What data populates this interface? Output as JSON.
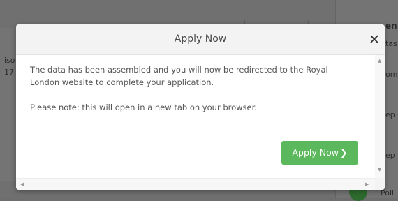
{
  "background": {
    "left_fragments": [
      "iso",
      "17"
    ],
    "right_fragments": [
      "en",
      "tas",
      "om",
      "ep",
      "ep",
      "Poli"
    ]
  },
  "modal": {
    "title": "Apply Now",
    "close_glyph": "✕",
    "message_line1": "The data has been assembled and you will now be redirected to the Royal London website to complete your application.",
    "message_line2": "Please note: this will open in a new tab on your browser.",
    "apply_label": "Apply Now",
    "apply_chevron": "❯",
    "accent_color": "#5cb85c"
  },
  "scrollbar": {
    "up_arrow": "▲",
    "down_arrow": "▼",
    "left_arrow": "◀",
    "right_arrow": "▶"
  }
}
